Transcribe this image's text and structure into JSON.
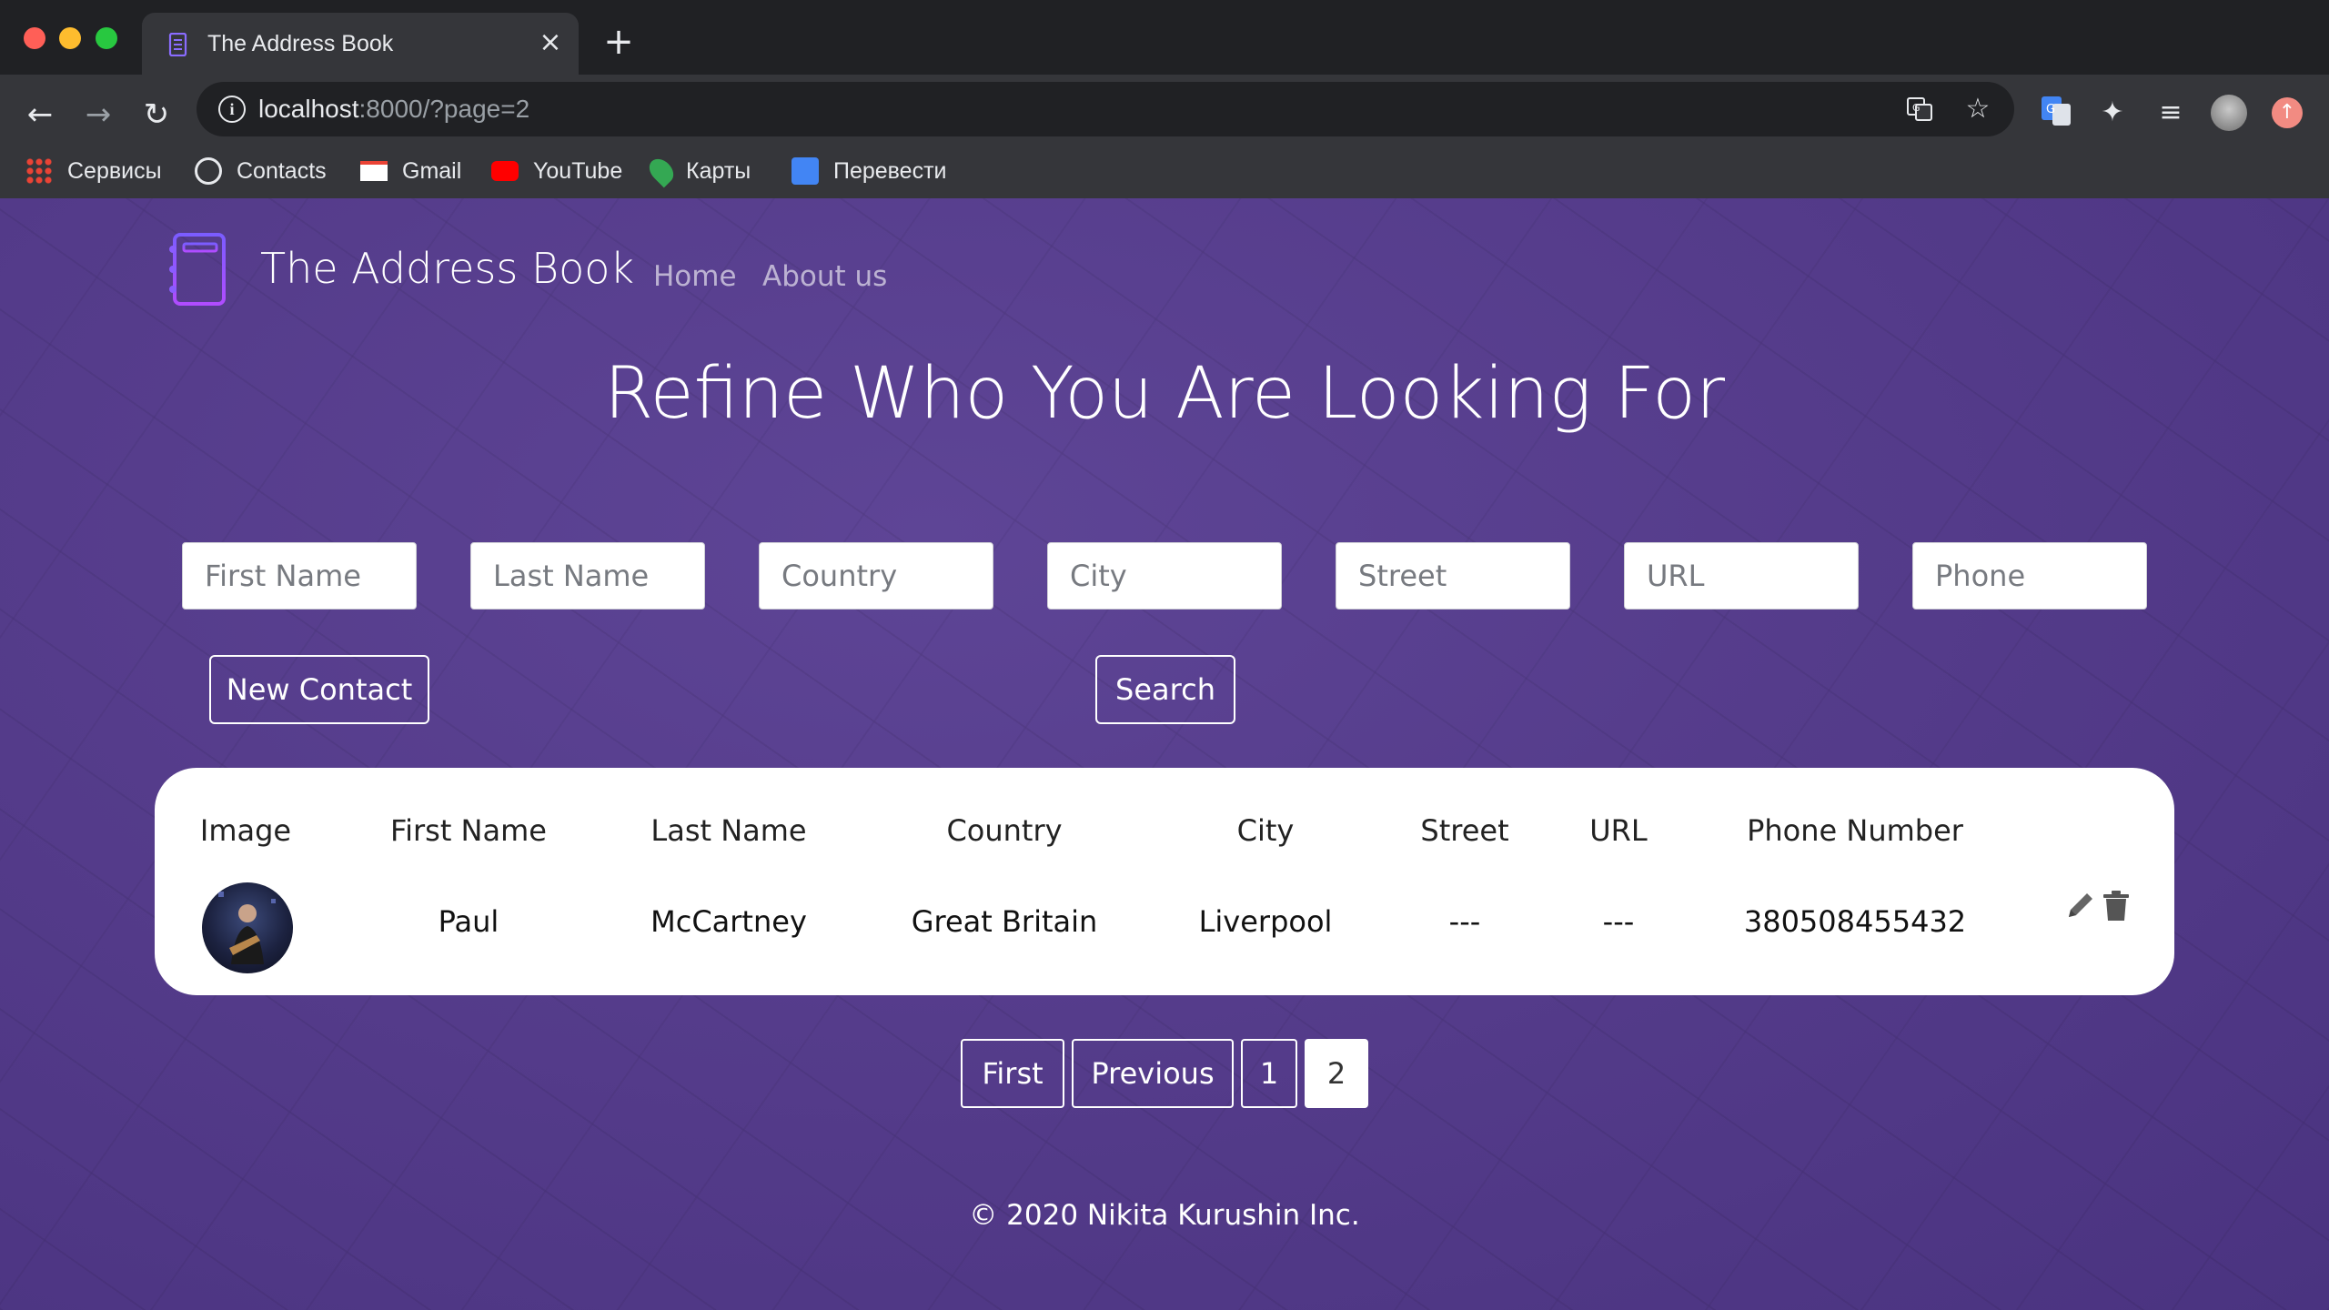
{
  "browser": {
    "tab_title": "The Address Book",
    "tab_close": "×",
    "new_tab": "+",
    "url_host": "localhost",
    "url_rest": ":8000/?page=2",
    "bookmarks": [
      "Сервисы",
      "Contacts",
      "Gmail",
      "YouTube",
      "Карты",
      "Перевести"
    ]
  },
  "site": {
    "brand": "The Address Book",
    "nav": [
      "Home",
      "About us"
    ],
    "hero_title": "Refine Who You Are Looking For"
  },
  "search": {
    "placeholders": [
      "First Name",
      "Last Name",
      "Country",
      "City",
      "Street",
      "URL",
      "Phone"
    ],
    "new_contact_label": "New Contact",
    "search_label": "Search"
  },
  "table": {
    "headers": [
      "Image",
      "First Name",
      "Last Name",
      "Country",
      "City",
      "Street",
      "URL",
      "Phone Number"
    ],
    "rows": [
      {
        "first_name": "Paul",
        "last_name": "McCartney",
        "country": "Great Britain",
        "city": "Liverpool",
        "street": "---",
        "url": "---",
        "phone": "380508455432"
      }
    ]
  },
  "pagination": [
    "First",
    "Previous",
    "1",
    "2"
  ],
  "pagination_active": "2",
  "footer": "© 2020 Nikita Kurushin Inc.",
  "colors": {
    "page_background": "#553c8b",
    "card": "#ffffff",
    "chrome_dark": "#202124",
    "chrome_toolbar": "#35363a"
  }
}
